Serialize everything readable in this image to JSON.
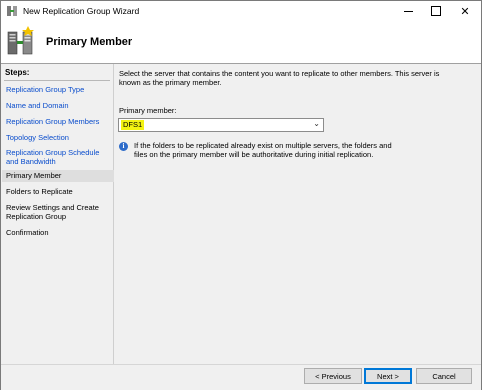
{
  "window": {
    "title": "New Replication Group Wizard",
    "minimize": "minimize",
    "maximize": "maximize",
    "close": "✕"
  },
  "header": {
    "title": "Primary Member",
    "icon": "replication-server-icon"
  },
  "sidebar": {
    "label": "Steps:",
    "items": [
      {
        "label": "Replication Group Type",
        "state": "link"
      },
      {
        "label": "Name and Domain",
        "state": "link"
      },
      {
        "label": "Replication Group Members",
        "state": "link"
      },
      {
        "label": "Topology Selection",
        "state": "link"
      },
      {
        "label": "Replication Group Schedule and Bandwidth",
        "state": "link"
      },
      {
        "label": "Primary Member",
        "state": "current"
      },
      {
        "label": "Folders to Replicate",
        "state": "pending"
      },
      {
        "label": "Review Settings and Create Replication Group",
        "state": "pending"
      },
      {
        "label": "Confirmation",
        "state": "pending"
      }
    ]
  },
  "main": {
    "description": "Select the server that contains the content you want to replicate to other members. This server is known as the primary member.",
    "primary_member_label": "Primary member:",
    "primary_member_value": "DFS1",
    "info_text": "If the folders to be replicated already exist on multiple servers, the folders and files on the primary member will be authoritative during initial replication."
  },
  "footer": {
    "previous": "< Previous",
    "next": "Next >",
    "cancel": "Cancel"
  },
  "colors": {
    "link": "#0a4dcc",
    "highlight": "#f3f312",
    "info": "#2d6bc9",
    "default_button_border": "#0078d7"
  }
}
